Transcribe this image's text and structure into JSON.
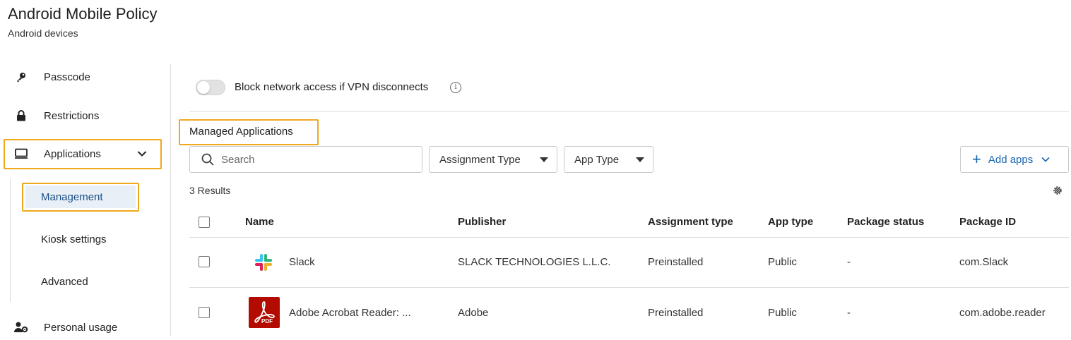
{
  "page": {
    "title": "Android Mobile Policy",
    "subtitle": "Android devices"
  },
  "sidebar": {
    "items": [
      {
        "label": "Passcode",
        "icon": "key-icon"
      },
      {
        "label": "Restrictions",
        "icon": "lock-icon"
      },
      {
        "label": "Applications",
        "icon": "monitor-icon",
        "expanded": true
      },
      {
        "label": "Personal usage",
        "icon": "user-gear-icon"
      }
    ],
    "subitems": [
      {
        "label": "Management",
        "active": true
      },
      {
        "label": "Kiosk settings"
      },
      {
        "label": "Advanced"
      }
    ]
  },
  "vpn_toggle": {
    "label": "Block network access if VPN disconnects",
    "on": false
  },
  "section_title": "Managed Applications",
  "toolbar": {
    "search_placeholder": "Search",
    "filter_assignment": "Assignment Type",
    "filter_app_type": "App Type",
    "add_apps": "Add apps"
  },
  "results_text": "3 Results",
  "table": {
    "columns": [
      "Name",
      "Publisher",
      "Assignment type",
      "App type",
      "Package status",
      "Package ID"
    ],
    "rows": [
      {
        "name": "Slack",
        "publisher": "SLACK TECHNOLOGIES L.L.C.",
        "assignment_type": "Preinstalled",
        "app_type": "Public",
        "package_status": "-",
        "package_id": "com.Slack",
        "icon": "slack-logo-icon"
      },
      {
        "name": "Adobe Acrobat Reader: ...",
        "publisher": "Adobe",
        "assignment_type": "Preinstalled",
        "app_type": "Public",
        "package_status": "-",
        "package_id": "com.adobe.reader",
        "icon": "adobe-pdf-icon",
        "icon_badge": "PDF"
      }
    ]
  },
  "colors": {
    "highlight": "#f0a81c",
    "accent": "#1a66b0",
    "active_bg": "#e9eff6",
    "adobe_red": "#b30b00"
  }
}
